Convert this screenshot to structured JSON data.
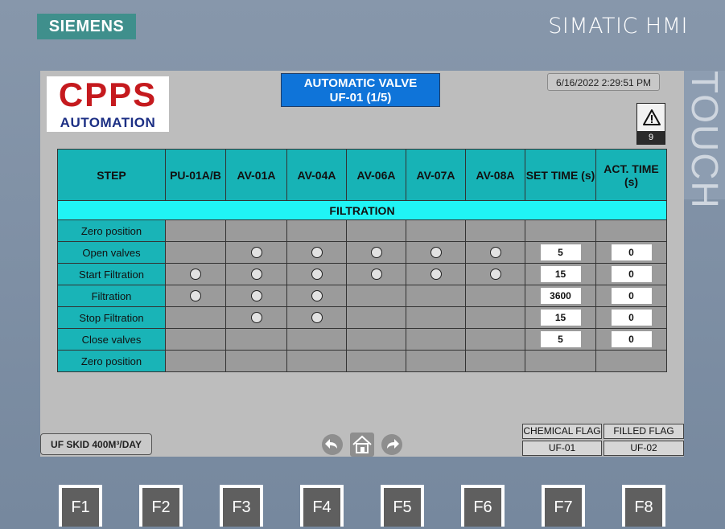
{
  "device": {
    "brand": "SIEMENS",
    "model": "SIMATIC HMI",
    "side_label": "TOUCH"
  },
  "logo": {
    "top": "CPPS",
    "bottom": "AUTOMATION"
  },
  "title": {
    "line1": "AUTOMATIC VALVE",
    "line2": "UF-01 (1/5)"
  },
  "datetime": "6/16/2022 2:29:51 PM",
  "alarm": {
    "icon": "warning-triangle-icon",
    "count": "9"
  },
  "table": {
    "headers": [
      "STEP",
      "PU-01A/B",
      "AV-01A",
      "AV-04A",
      "AV-06A",
      "AV-07A",
      "AV-08A",
      "SET TIME (s)",
      "ACT. TIME (s)"
    ],
    "section": "FILTRATION",
    "rows": [
      {
        "step": "Zero position",
        "valves": [
          false,
          false,
          false,
          false,
          false,
          false
        ],
        "set_time": "",
        "act_time": ""
      },
      {
        "step": "Open valves",
        "valves": [
          false,
          true,
          true,
          true,
          true,
          true
        ],
        "set_time": "5",
        "act_time": "0"
      },
      {
        "step": "Start Filtration",
        "valves": [
          true,
          true,
          true,
          true,
          true,
          true
        ],
        "set_time": "15",
        "act_time": "0"
      },
      {
        "step": "Filtration",
        "valves": [
          true,
          true,
          true,
          false,
          false,
          false
        ],
        "set_time": "3600",
        "act_time": "0"
      },
      {
        "step": "Stop Filtration",
        "valves": [
          false,
          true,
          true,
          false,
          false,
          false
        ],
        "set_time": "15",
        "act_time": "0"
      },
      {
        "step": "Close valves",
        "valves": [
          false,
          false,
          false,
          false,
          false,
          false
        ],
        "set_time": "5",
        "act_time": "0"
      },
      {
        "step": "Zero position",
        "valves": [
          false,
          false,
          false,
          false,
          false,
          false
        ],
        "set_time": "",
        "act_time": ""
      }
    ]
  },
  "footer": {
    "skid_label": "UF SKID 400M³/DAY",
    "nav": [
      "back-arrow-icon",
      "home-icon",
      "forward-arrow-icon"
    ],
    "flags": [
      {
        "label": "CHEMICAL FLAG",
        "value": "UF-01"
      },
      {
        "label": "FILLED FLAG",
        "value": "UF-02"
      }
    ]
  },
  "function_keys": [
    "F1",
    "F2",
    "F3",
    "F4",
    "F5",
    "F6",
    "F7",
    "F8"
  ],
  "colors": {
    "header": "#17b3b6",
    "section": "#20f4f5",
    "title_bg": "#0f74d9",
    "logo_red": "#c51a1e",
    "logo_blue": "#1c2f84"
  }
}
